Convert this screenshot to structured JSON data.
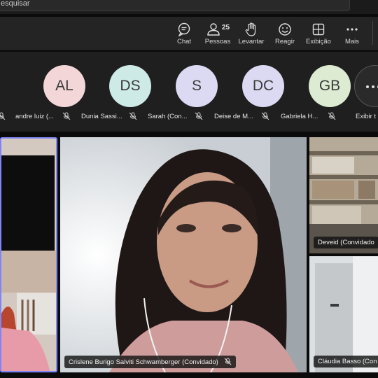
{
  "search": {
    "placeholder": "esquisar"
  },
  "toolbar": {
    "chat": "Chat",
    "people": "Pessoas",
    "people_count": "25",
    "raise": "Levantar",
    "react": "Reagir",
    "view": "Exibição",
    "more": "Mais"
  },
  "attendees": [
    {
      "initials": "AL",
      "name": "andre luiz (...",
      "color": "#f3d6d8"
    },
    {
      "initials": "DS",
      "name": "Dunia Sassi...",
      "color": "#cdeae6"
    },
    {
      "initials": "S",
      "name": "Sarah (Con...",
      "color": "#dcdaf2"
    },
    {
      "initials": "DC",
      "name": "Deise de M...",
      "color": "#dcdaf2"
    },
    {
      "initials": "GB",
      "name": "Gabriela H...",
      "color": "#dcebd2"
    }
  ],
  "show_all": "Exibir t",
  "tiles": {
    "main_name": "Crislene Burigo Salviti Schwamberger (Convidado)",
    "r1_name": "Deveid (Convidado",
    "r2_name": "Cláudia Basso (Con"
  },
  "colors": {
    "accent": "#7f85f5",
    "toolbar_bg": "#242424",
    "strip_bg": "#1f1f1f"
  }
}
